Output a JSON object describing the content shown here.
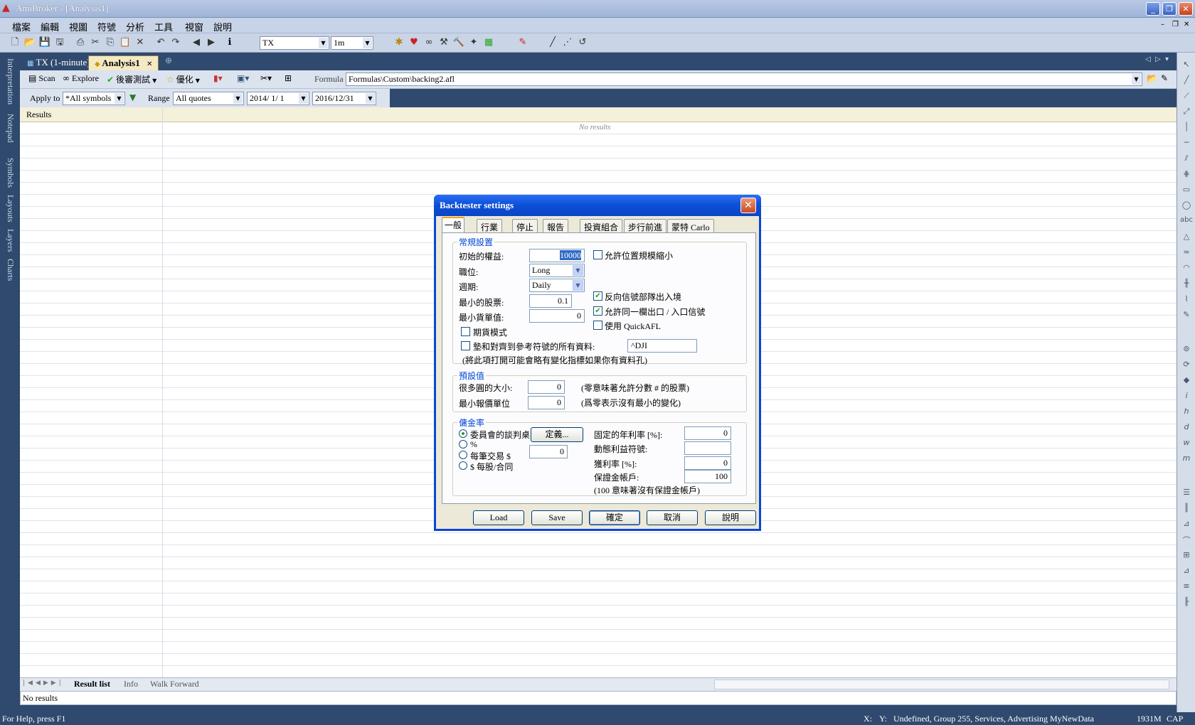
{
  "window": {
    "title": "AmiBroker - [Analysis1]"
  },
  "menu": [
    "檔案",
    "編輯",
    "視圖",
    "符號",
    "分析",
    "工具",
    "視窗",
    "說明"
  ],
  "toolbar": {
    "symbol": "TX",
    "interval": "1m"
  },
  "side_tabs": [
    "Interpretation",
    "Notepad",
    "Symbols",
    "Layouts",
    "Layers",
    "Charts"
  ],
  "doc_tabs": [
    "TX (1-minute)",
    "Analysis1"
  ],
  "analysis_toolbar": {
    "scan": "Scan",
    "explore": "Explore",
    "backtest": "後審測試",
    "optimize": "優化",
    "formula_label": "Formula",
    "formula_path": "Formulas\\Custom\\backing2.afl",
    "apply_to_label": "Apply to",
    "apply_to": "*All symbols",
    "range_label": "Range",
    "range": "All quotes",
    "from_date": "2014/ 1/ 1",
    "to_date": "2016/12/31"
  },
  "results": {
    "header": "Results",
    "empty_text": "No results"
  },
  "bottom_tabs": [
    "Result list",
    "Info",
    "Walk Forward"
  ],
  "status": {
    "inner": "No results",
    "help": "For Help, press F1",
    "x": "X:",
    "y": "Y:",
    "group_info": "Undefined, Group 255, Services, Advertising",
    "database": "MyNewData",
    "memory": "1931M",
    "caps": "CAP"
  },
  "dialog": {
    "title": "Backtester settings",
    "tabs": [
      "一般",
      "行業",
      "停止",
      "報告",
      "投資組合",
      "步行前進",
      "蒙特 Carlo"
    ],
    "general": {
      "group": "常規設置",
      "initial_equity_label": "初始的權益:",
      "initial_equity": "10000",
      "positions_label": "職位:",
      "positions": "Long",
      "periodicity_label": "週期:",
      "periodicity": "Daily",
      "min_shares_label": "最小的股票:",
      "min_shares": "0.1",
      "min_pos_value_label": "最小貨單值:",
      "min_pos_value": "0",
      "futures_mode": "期貨模式",
      "pad_align": "墊和對齊到參考符號的所有資料:",
      "pad_symbol": "^DJI",
      "pad_note": "(將此項打開可能會略有變化指標如果你有資料孔)",
      "allow_shrink": "允許位置規模縮小",
      "reverse_signal": "反向信號部隊出入境",
      "allow_same_bar": "允許同一欄出口 / 入口信號",
      "use_quickafl": "使用 QuickAFL"
    },
    "defaults": {
      "group": "預設值",
      "round_lot_label": "很多圓的大小:",
      "round_lot": "0",
      "round_lot_note": "(零意味著允許分數 # 的股票)",
      "tick_size_label": "最小報價單位",
      "tick_size": "0",
      "tick_size_note": "(爲零表示沒有最小的變化)"
    },
    "commission": {
      "group": "傭金率",
      "options": [
        "委員會的談判桌",
        "%",
        "每筆交易 $",
        "$ 每股/合同"
      ],
      "define_button": "定義...",
      "per_trade_value": "0",
      "annual_interest_label": "固定的年利率 [%]:",
      "annual_interest": "0",
      "dynamic_rate_label": "動態利益符號:",
      "dynamic_rate": "",
      "margin_interest_label": "獲利率 [%]:",
      "margin_interest": "0",
      "account_margin_label": "保證金帳戶:",
      "account_margin": "100",
      "account_margin_note": "(100 意味著沒有保證金帳戶)"
    },
    "buttons": {
      "load": "Load",
      "save": "Save",
      "ok": "確定",
      "cancel": "取消",
      "help": "說明"
    }
  }
}
